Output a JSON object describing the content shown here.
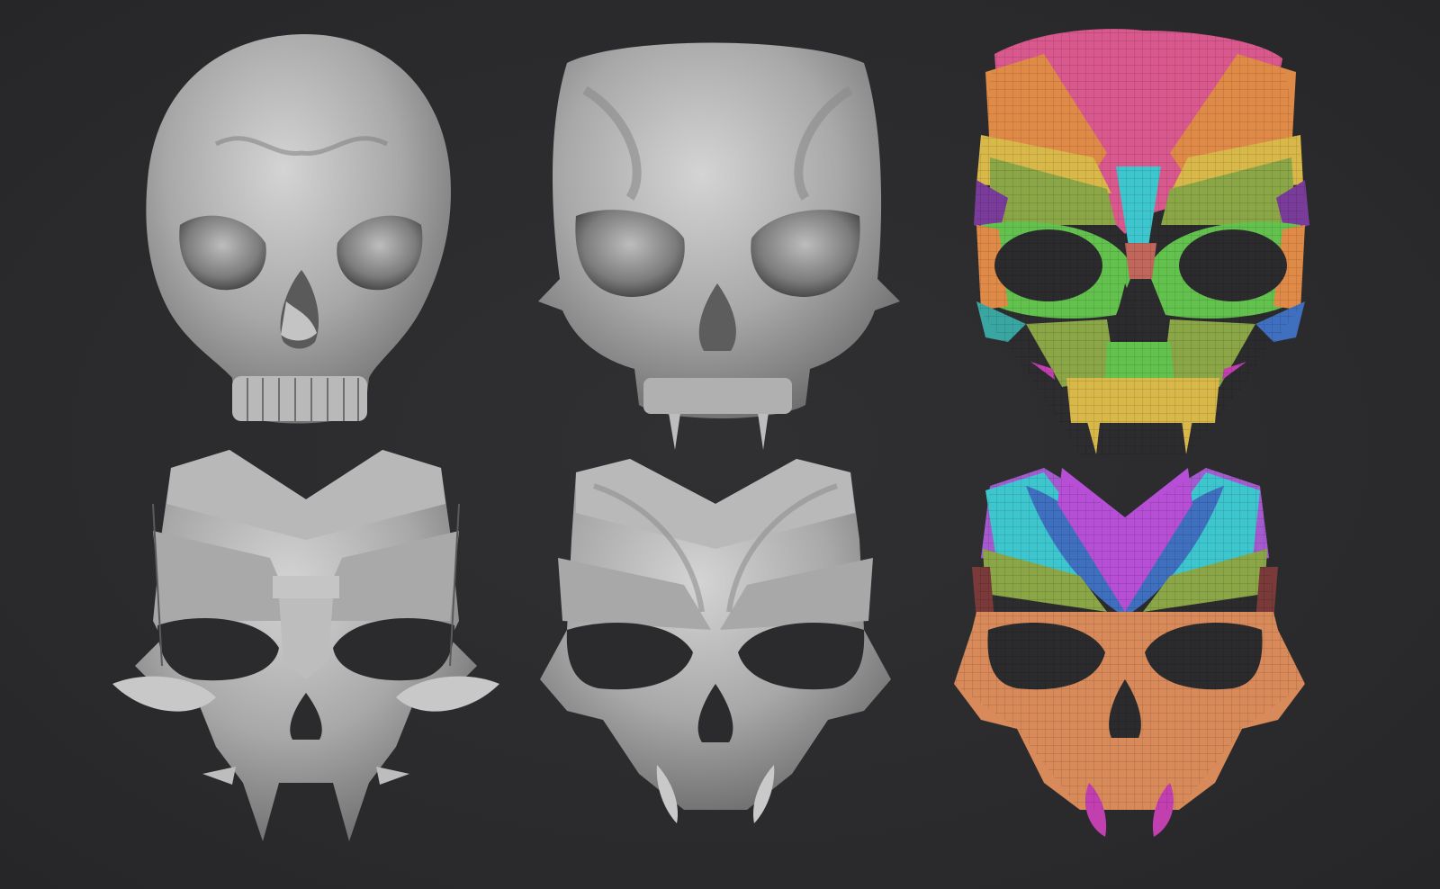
{
  "scene": {
    "background": "#2b2b2d",
    "layout": "2-rows-3-columns",
    "colors": {
      "clay_light": "#c9c9c9",
      "clay_mid": "#9a9a9a",
      "clay_dark": "#4a4a4a",
      "eye_dark": "#2b2b2d",
      "poly_pink": "#d9588e",
      "poly_orange": "#e08a48",
      "poly_green": "#63c24e",
      "poly_cyan": "#3ec6cf",
      "poly_purple": "#7a3c9a",
      "poly_yellow": "#d9b84a",
      "poly_blue": "#3f6fbf",
      "poly_violet": "#b64fd6",
      "poly_teal": "#3aa6a2",
      "poly_skin": "#d98a5a",
      "poly_olive": "#8aa646",
      "poly_magenta": "#c23fb0"
    },
    "items": [
      {
        "name": "skull-sculpt",
        "style": "clay"
      },
      {
        "name": "demon-skull-sculpt",
        "style": "clay"
      },
      {
        "name": "demon-skull-polygroups",
        "style": "polygroups"
      },
      {
        "name": "hard-surface-mask",
        "style": "clay"
      },
      {
        "name": "smooth-mask",
        "style": "clay"
      },
      {
        "name": "mask-polygroups",
        "style": "polygroups"
      }
    ]
  }
}
